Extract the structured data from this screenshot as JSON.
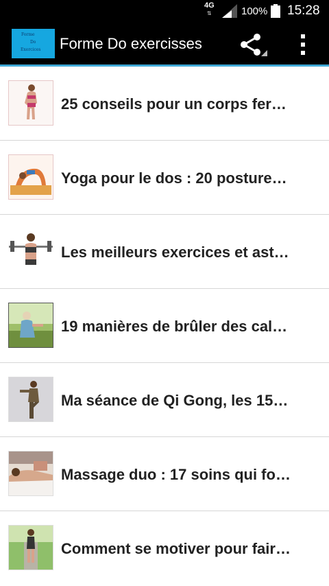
{
  "status_bar": {
    "network": "4G",
    "battery_percent": "100%",
    "time": "15:28"
  },
  "action_bar": {
    "logo_lines": [
      "Forme",
      "Do",
      "Exercices"
    ],
    "title": "Forme Do exercisses",
    "icons": [
      "share-icon",
      "overflow-menu-icon"
    ]
  },
  "articles": [
    {
      "title": "25 conseils pour un corps fer…",
      "thumb_icon": "fitness-woman-thumbnail"
    },
    {
      "title": "Yoga pour le dos : 20 posture…",
      "thumb_icon": "yoga-backbend-thumbnail"
    },
    {
      "title": "Les meilleurs exercices et ast…",
      "thumb_icon": "barbell-woman-thumbnail"
    },
    {
      "title": "19 manières de brûler des cal…",
      "thumb_icon": "runner-park-thumbnail"
    },
    {
      "title": "Ma séance de Qi Gong, les 15…",
      "thumb_icon": "qigong-pose-thumbnail"
    },
    {
      "title": "Massage duo : 17 soins qui fo…",
      "thumb_icon": "massage-thumbnail"
    },
    {
      "title": "Comment se motiver pour fair…",
      "thumb_icon": "jogger-thumbnail"
    }
  ]
}
